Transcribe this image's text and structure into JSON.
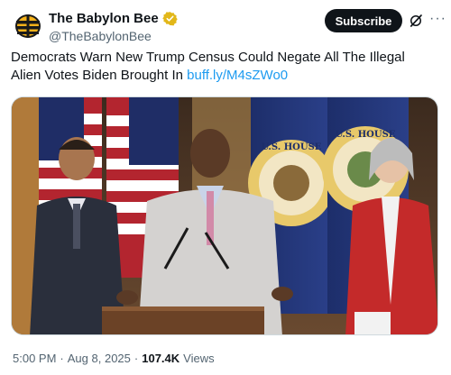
{
  "account": {
    "display_name": "The Babylon Bee",
    "handle": "@TheBabylonBee"
  },
  "actions": {
    "subscribe_label": "Subscribe",
    "more_label": "···"
  },
  "tweet": {
    "text": "Democrats Warn New Trump Census Could Negate All The Illegal Alien Votes Biden Brought In ",
    "link": "buff.ly/M4sZWo0"
  },
  "media": {
    "seal_texts": [
      "U.S. HOUSE OF REPRESENTATIVES",
      "U.S. HOUSE OF REPRESENTATIVES"
    ]
  },
  "meta": {
    "time": "5:00 PM",
    "date": "Aug 8, 2025",
    "separator": "·",
    "views_count": "107.4K",
    "views_label": "Views"
  },
  "colors": {
    "verified_gold": "#e2b719",
    "link_blue": "#1d9bf0",
    "subscribe_bg": "#0f1419"
  },
  "icons": {
    "avatar": "bee-logo-icon",
    "verified": "verified-badge-icon",
    "grok": "grok-icon",
    "more": "more-options-icon"
  }
}
